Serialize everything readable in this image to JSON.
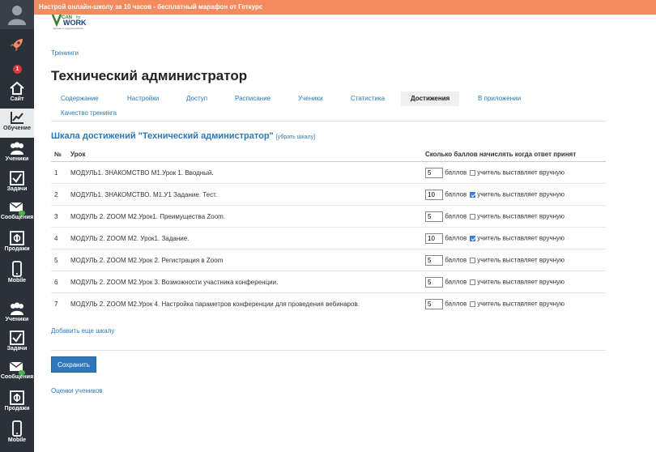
{
  "banner": {
    "text": "Настрой онлайн-школу за 10 часов - бесплатный марафон от Геткурс"
  },
  "logo": {
    "text": "V CAN for WORK",
    "subtitle": "партнёр в трудоустройстве"
  },
  "sidebar": {
    "badge": "1",
    "items": [
      {
        "label": "Сайт",
        "icon": "home-icon"
      },
      {
        "label": "Обучение",
        "icon": "chart-icon",
        "active": true
      },
      {
        "label": "Ученики",
        "icon": "users-icon"
      },
      {
        "label": "Задачи",
        "icon": "check-icon"
      },
      {
        "label": "Сообщения",
        "icon": "mail-icon"
      },
      {
        "label": "Продажи",
        "icon": "sales-icon"
      },
      {
        "label": "Mobile",
        "icon": "phone-icon"
      },
      {
        "label": "Ученики",
        "icon": "users-icon"
      },
      {
        "label": "Задачи",
        "icon": "check-icon"
      },
      {
        "label": "Сообщения",
        "icon": "mail-icon"
      },
      {
        "label": "Продажи",
        "icon": "sales-icon"
      },
      {
        "label": "Mobile",
        "icon": "phone-icon"
      }
    ]
  },
  "breadcrumb": "Тренинги",
  "page_title": "Технический администратор",
  "tabs": [
    {
      "label": "Содержание"
    },
    {
      "label": "Настройки"
    },
    {
      "label": "Доступ"
    },
    {
      "label": "Расписание"
    },
    {
      "label": "Ученики"
    },
    {
      "label": "Статистика"
    },
    {
      "label": "Достижения",
      "active": true
    },
    {
      "label": "В приложении"
    },
    {
      "label": "Качество тренинга"
    }
  ],
  "section": {
    "title": "Шкала достижений \"Технический администратор\"",
    "remove_link": "[убрать шкалу]"
  },
  "table": {
    "headers": {
      "num": "№",
      "lesson": "Урок",
      "points": "Сколько баллов начислять когда ответ принят"
    },
    "points_unit": "баллов",
    "manual_label": "учитель выставляет вручную",
    "rows": [
      {
        "num": "1",
        "lesson": "МОДУЛЬ1. ЗНАКОМСТВО М1.Урок 1. Вводный.",
        "points": "5",
        "manual": false
      },
      {
        "num": "2",
        "lesson": "МОДУЛЬ1. ЗНАКОМСТВО. М1.У1 Задание. Тест.",
        "points": "10",
        "manual": true
      },
      {
        "num": "3",
        "lesson": "МОДУЛЬ 2. ZOOM М2.Урок1. Преимущества Zoom.",
        "points": "5",
        "manual": false
      },
      {
        "num": "4",
        "lesson": "МОДУЛЬ 2. ZOOM М2. Урок1. Задание.",
        "points": "10",
        "manual": true
      },
      {
        "num": "5",
        "lesson": "МОДУЛЬ 2. ZOOM М2.Урок 2. Регистрация в Zoom",
        "points": "5",
        "manual": false
      },
      {
        "num": "6",
        "lesson": "МОДУЛЬ 2. ZOOM М2.Урок 3. Возможности участника конференции.",
        "points": "5",
        "manual": false
      },
      {
        "num": "7",
        "lesson": "МОДУЛЬ 2. ZOOM М2.Урок 4. Настройка параметров конференции для проведения вебинаров.",
        "points": "5",
        "manual": false
      }
    ]
  },
  "add_scale_link": "Добавить еще шкалу",
  "save_button": "Сохранить",
  "grades_link": "Оценки учеников",
  "colors": {
    "accent": "#2a7ab8",
    "banner": "#f38b5e",
    "sidebar": "#2b3139",
    "button": "#2e77bb"
  }
}
